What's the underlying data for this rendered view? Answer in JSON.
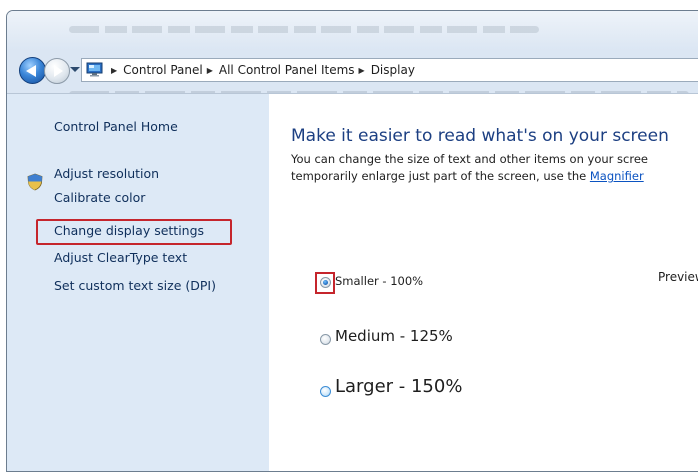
{
  "address_bar": {
    "crumbs": [
      "Control Panel",
      "All Control Panel Items",
      "Display"
    ]
  },
  "sidebar": {
    "home_label": "Control Panel Home",
    "tasks": [
      {
        "label": "Adjust resolution",
        "icon": null
      },
      {
        "label": "Calibrate color",
        "icon": "shield-icon"
      },
      {
        "label": "Change display settings",
        "icon": null,
        "highlighted": true
      },
      {
        "label": "Adjust ClearType text",
        "icon": null
      },
      {
        "label": "Set custom text size (DPI)",
        "icon": null
      }
    ]
  },
  "main": {
    "title": "Make it easier to read what's on your screen",
    "desc_line1": "You can change the size of text and other items on your scree",
    "desc_line2_prefix": "temporarily enlarge just part of the screen, use the ",
    "desc_link": "Magnifier",
    "preview_label": "Preview",
    "options": [
      {
        "label": "Smaller - 100%",
        "checked": true
      },
      {
        "label": "Medium - 125%",
        "checked": false
      },
      {
        "label": "Larger - 150%",
        "checked": false
      }
    ]
  },
  "colors": {
    "accent": "#1c3f82",
    "highlight_box": "#c5252c",
    "sidebar_bg": "#dde9f6",
    "link": "#0b53c1"
  }
}
